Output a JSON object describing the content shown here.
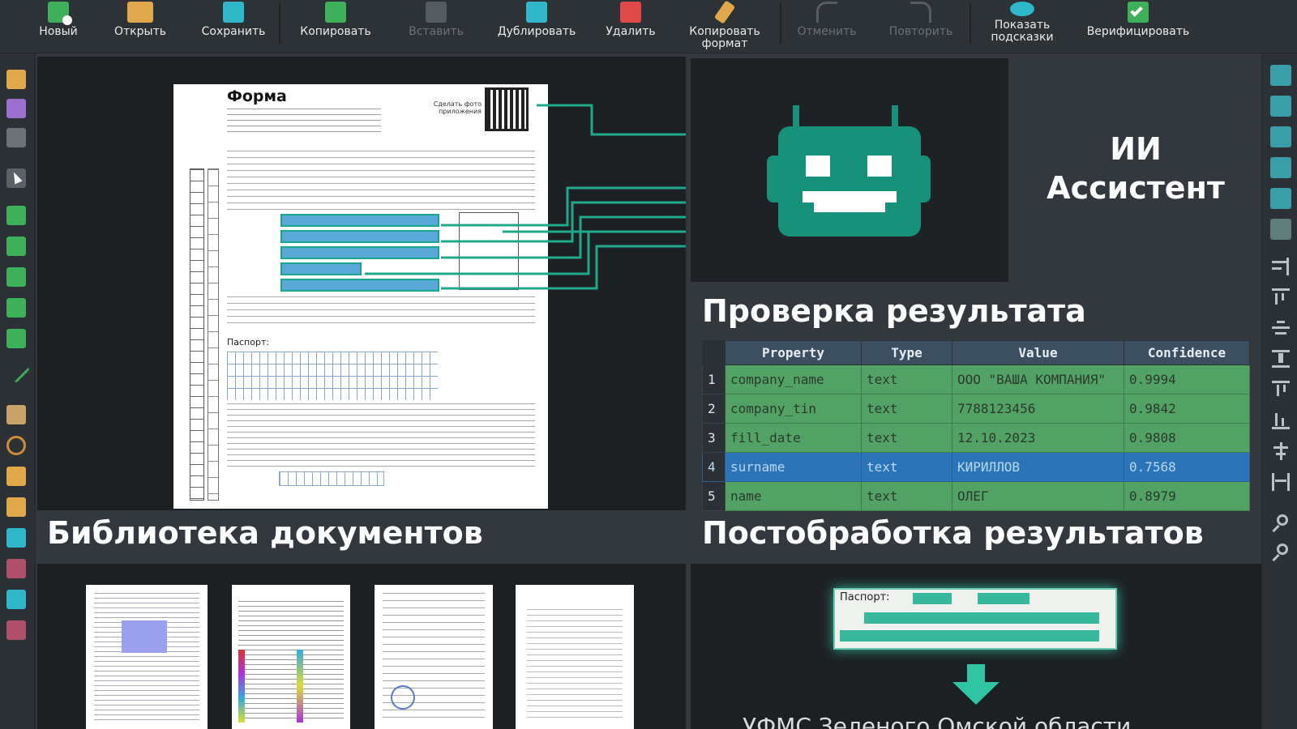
{
  "toolbar": {
    "buttons": [
      {
        "label": "Новый",
        "icon": "new-doc-icon",
        "color": "#3fb05a",
        "disabled": false
      },
      {
        "label": "Открыть",
        "icon": "open-folder-icon",
        "color": "#e0a84a",
        "disabled": false
      },
      {
        "label": "Сохранить",
        "icon": "save-icon",
        "color": "#2fb8c9",
        "disabled": false
      },
      {
        "label": "Копировать",
        "icon": "copy-icon",
        "color": "#3fb05a",
        "disabled": false
      },
      {
        "label": "Вставить",
        "icon": "paste-icon",
        "color": "#8a8f95",
        "disabled": true
      },
      {
        "label": "Дублировать",
        "icon": "duplicate-icon",
        "color": "#2fb8c9",
        "disabled": false
      },
      {
        "label": "Удалить",
        "icon": "delete-icon",
        "color": "#e0484a",
        "disabled": false
      },
      {
        "label": "Копировать\nформат",
        "icon": "format-brush-icon",
        "color": "#e0a84a",
        "disabled": false
      },
      {
        "label": "Отменить",
        "icon": "undo-icon",
        "color": "#8a8f95",
        "disabled": true
      },
      {
        "label": "Повторить",
        "icon": "redo-icon",
        "color": "#8a8f95",
        "disabled": true
      },
      {
        "label": "Показать\nподсказки",
        "icon": "show-hints-icon",
        "color": "#2fb8c9",
        "disabled": false
      },
      {
        "label": "Верифицировать",
        "icon": "verify-icon",
        "color": "#3fb05a",
        "disabled": false
      }
    ]
  },
  "document": {
    "form_title": "Форма",
    "qr_caption": "Сделать фото\nприложения",
    "passport_label": "Паспорт:"
  },
  "ai": {
    "title_line1": "ИИ",
    "title_line2": "Ассистент",
    "accent": "#17917a"
  },
  "verification": {
    "title": "Проверка результата",
    "columns": [
      "Property",
      "Type",
      "Value",
      "Confidence"
    ],
    "rows": [
      {
        "n": "1",
        "property": "company_name",
        "type": "text",
        "value": "ООО \"ВАША КОМПАНИЯ\"",
        "confidence": "0.9994",
        "selected": false
      },
      {
        "n": "2",
        "property": "company_tin",
        "type": "text",
        "value": "7788123456",
        "confidence": "0.9842",
        "selected": false
      },
      {
        "n": "3",
        "property": "fill_date",
        "type": "text",
        "value": "12.10.2023",
        "confidence": "0.9808",
        "selected": false
      },
      {
        "n": "4",
        "property": "surname",
        "type": "text",
        "value": "КИРИЛЛОВ",
        "confidence": "0.7568",
        "selected": true
      },
      {
        "n": "5",
        "property": "name",
        "type": "text",
        "value": "ОЛЕГ",
        "confidence": "0.8979",
        "selected": false
      }
    ]
  },
  "library": {
    "title": "Библиотека документов"
  },
  "postprocessing": {
    "title": "Постобработка результатов",
    "passport_label": "Паспорт:",
    "result_text": "УФМС Зеленого Омской области"
  }
}
